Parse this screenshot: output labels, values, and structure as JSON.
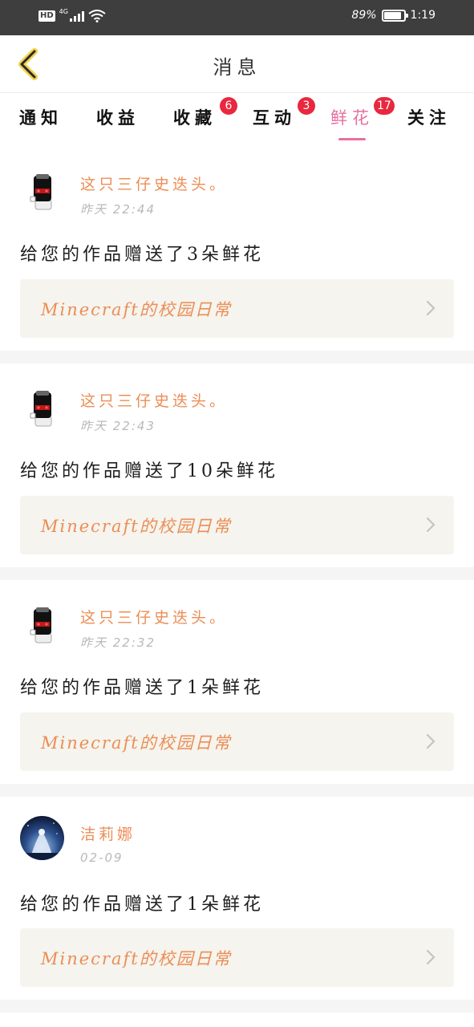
{
  "status_bar": {
    "hd": "HD",
    "network": "4G",
    "battery_percent": "89%",
    "battery_level": 0.89,
    "time": "1:19"
  },
  "nav": {
    "title": "消息",
    "back_icon": "chevron-left-icon"
  },
  "tabs": [
    {
      "label": "通知",
      "badge": ""
    },
    {
      "label": "收益",
      "badge": ""
    },
    {
      "label": "收藏",
      "badge": "6"
    },
    {
      "label": "互动",
      "badge": "3"
    },
    {
      "label": "鲜花",
      "badge": "17",
      "active": true
    },
    {
      "label": "关注",
      "badge": ""
    }
  ],
  "colors": {
    "accent_pink": "#e86fa0",
    "badge_red": "#e8283f",
    "username_orange": "#ec8d55",
    "link_bg": "#f5f4ee"
  },
  "notifications": [
    {
      "username": "这只三仔史迭头。",
      "time": "昨天  22:44",
      "message": "给您的作品赠送了3朵鲜花",
      "work_title": "Minecraft的校园日常",
      "avatar": "black-hooded-character-avatar"
    },
    {
      "username": "这只三仔史迭头。",
      "time": "昨天  22:43",
      "message": "给您的作品赠送了10朵鲜花",
      "work_title": "Minecraft的校园日常",
      "avatar": "black-hooded-character-avatar"
    },
    {
      "username": "这只三仔史迭头。",
      "time": "昨天  22:32",
      "message": "给您的作品赠送了1朵鲜花",
      "work_title": "Minecraft的校园日常",
      "avatar": "black-hooded-character-avatar"
    },
    {
      "username": "洁莉娜",
      "time": "02-09",
      "message": "给您的作品赠送了1朵鲜花",
      "work_title": "Minecraft的校园日常",
      "avatar": "night-sky-character-avatar"
    }
  ]
}
